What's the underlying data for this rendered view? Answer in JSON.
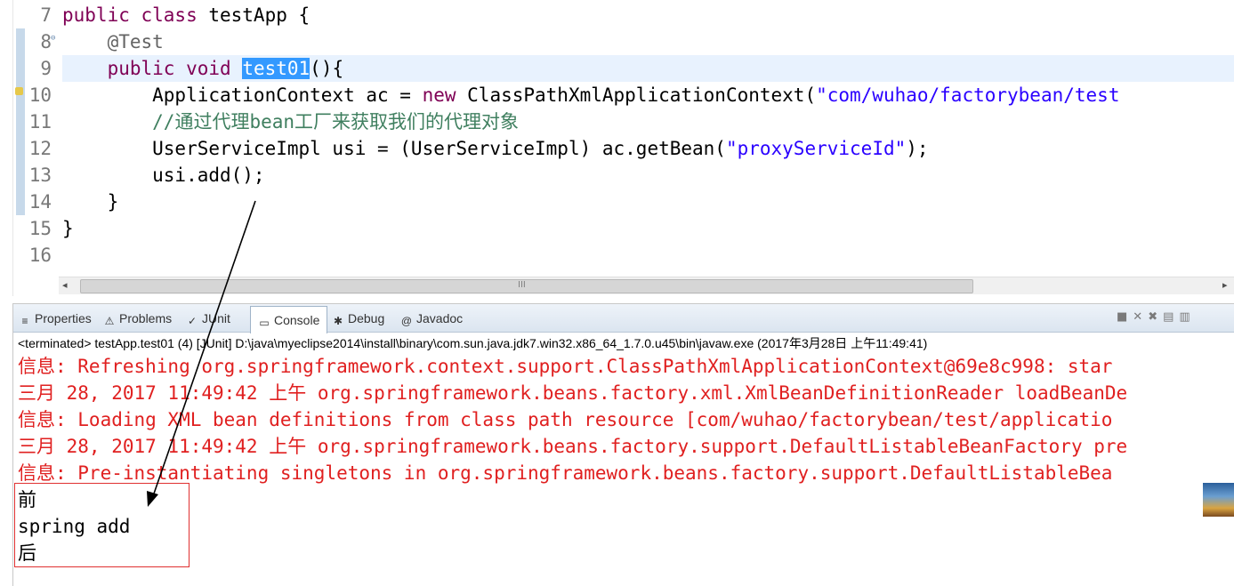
{
  "editor": {
    "line_numbers": [
      "7",
      "8",
      "9",
      "10",
      "11",
      "12",
      "13",
      "14",
      "15",
      "16"
    ],
    "lines": [
      {
        "parts": [
          {
            "t": "public class",
            "c": "kw"
          },
          {
            "t": " testApp {",
            "c": ""
          }
        ]
      },
      {
        "parts": [
          {
            "t": "    @Test",
            "c": "ann"
          }
        ]
      },
      {
        "parts": [
          {
            "t": "    ",
            "c": ""
          },
          {
            "t": "public void",
            "c": "kw"
          },
          {
            "t": " ",
            "c": ""
          },
          {
            "t": "test01",
            "c": "sel"
          },
          {
            "t": "(){",
            "c": ""
          }
        ]
      },
      {
        "parts": [
          {
            "t": "        ApplicationContext ac = ",
            "c": ""
          },
          {
            "t": "new",
            "c": "kw"
          },
          {
            "t": " ClassPathXmlApplicationContext(",
            "c": ""
          },
          {
            "t": "\"com/wuhao/factorybean/test",
            "c": "str"
          }
        ]
      },
      {
        "parts": [
          {
            "t": "        ",
            "c": ""
          },
          {
            "t": "//通过代理bean工厂来获取我们的代理对象",
            "c": "cmt"
          }
        ]
      },
      {
        "parts": [
          {
            "t": "        UserServiceImpl usi = (UserServiceImpl) ac.getBean(",
            "c": ""
          },
          {
            "t": "\"proxyServiceId\"",
            "c": "str"
          },
          {
            "t": ");",
            "c": ""
          }
        ]
      },
      {
        "parts": [
          {
            "t": "        usi.add();",
            "c": ""
          }
        ]
      },
      {
        "parts": [
          {
            "t": "    }",
            "c": ""
          }
        ]
      },
      {
        "parts": [
          {
            "t": "}",
            "c": ""
          }
        ]
      },
      {
        "parts": []
      }
    ],
    "scroll_grip": "III"
  },
  "console": {
    "tabs": [
      {
        "label": "Properties",
        "icon": "properties-icon",
        "glyph": "≡",
        "active": false
      },
      {
        "label": "Problems",
        "icon": "problems-icon",
        "glyph": "⚠",
        "active": false
      },
      {
        "label": "JUnit",
        "icon": "junit-icon",
        "glyph": "✓",
        "active": false
      },
      {
        "label": "Console",
        "icon": "console-icon",
        "glyph": "▭",
        "active": true
      },
      {
        "label": "Debug",
        "icon": "debug-icon",
        "glyph": "✱",
        "active": false
      },
      {
        "label": "Javadoc",
        "icon": "javadoc-icon",
        "glyph": "@",
        "active": false
      }
    ],
    "terminated_line": "<terminated> testApp.test01 (4) [JUnit] D:\\java\\myeclipse2014\\install\\binary\\com.sun.java.jdk7.win32.x86_64_1.7.0.u45\\bin\\javaw.exe (2017年3月28日 上午11:49:41)",
    "log_lines": [
      "信息: Refreshing org.springframework.context.support.ClassPathXmlApplicationContext@69e8c998: star",
      "三月 28, 2017 11:49:42 上午 org.springframework.beans.factory.xml.XmlBeanDefinitionReader loadBeanDe",
      "信息: Loading XML bean definitions from class path resource [com/wuhao/factorybean/test/applicatio",
      "三月 28, 2017 11:49:42 上午 org.springframework.beans.factory.support.DefaultListableBeanFactory pre",
      "信息: Pre-instantiating singletons in org.springframework.beans.factory.support.DefaultListableBea"
    ],
    "output_lines": [
      "前",
      "spring add",
      "后"
    ],
    "colors": {
      "log_red": "#e02020",
      "box_red": "#e03030"
    }
  }
}
